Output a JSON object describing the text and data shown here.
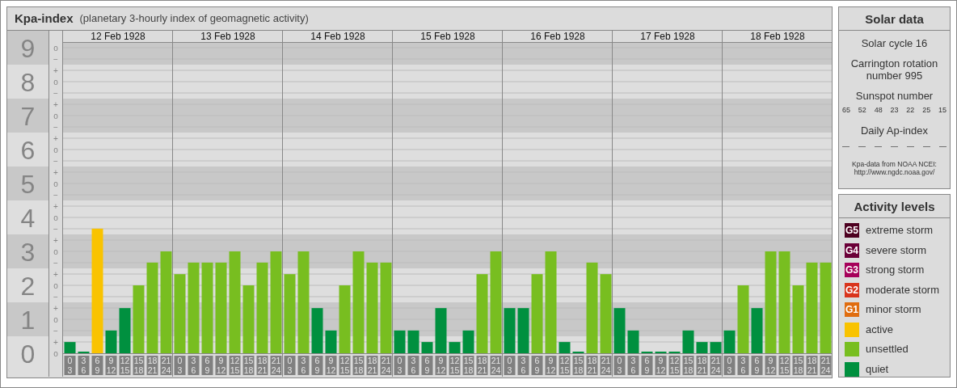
{
  "title": {
    "name": "Kpa-index",
    "subtitle": "(planetary 3-hourly index of geomagnetic activity)"
  },
  "chart": {
    "days": [
      {
        "date": "12 Feb 1928",
        "slots": [
          [
            "0",
            "3"
          ],
          [
            "3",
            "6"
          ],
          [
            "6",
            "9"
          ],
          [
            "9",
            "12"
          ],
          [
            "12",
            "15"
          ],
          [
            "15",
            "18"
          ],
          [
            "18",
            "21"
          ],
          [
            "21",
            "24"
          ]
        ]
      },
      {
        "date": "13 Feb 1928",
        "slots": [
          [
            "0",
            "3"
          ],
          [
            "3",
            "6"
          ],
          [
            "6",
            "9"
          ],
          [
            "9",
            "12"
          ],
          [
            "12",
            "15"
          ],
          [
            "15",
            "18"
          ],
          [
            "18",
            "21"
          ],
          [
            "21",
            "24"
          ]
        ]
      },
      {
        "date": "14 Feb 1928",
        "slots": [
          [
            "0",
            "3"
          ],
          [
            "3",
            "6"
          ],
          [
            "6",
            "9"
          ],
          [
            "9",
            "12"
          ],
          [
            "12",
            "15"
          ],
          [
            "15",
            "18"
          ],
          [
            "18",
            "21"
          ],
          [
            "21",
            "24"
          ]
        ]
      },
      {
        "date": "15 Feb 1928",
        "slots": [
          [
            "0",
            "3"
          ],
          [
            "3",
            "6"
          ],
          [
            "6",
            "9"
          ],
          [
            "9",
            "12"
          ],
          [
            "12",
            "15"
          ],
          [
            "15",
            "18"
          ],
          [
            "18",
            "21"
          ],
          [
            "21",
            "24"
          ]
        ]
      },
      {
        "date": "16 Feb 1928",
        "slots": [
          [
            "0",
            "3"
          ],
          [
            "3",
            "6"
          ],
          [
            "6",
            "9"
          ],
          [
            "9",
            "12"
          ],
          [
            "12",
            "15"
          ],
          [
            "15",
            "18"
          ],
          [
            "18",
            "21"
          ],
          [
            "21",
            "24"
          ]
        ]
      },
      {
        "date": "17 Feb 1928",
        "slots": [
          [
            "0",
            "3"
          ],
          [
            "3",
            "6"
          ],
          [
            "6",
            "9"
          ],
          [
            "9",
            "12"
          ],
          [
            "12",
            "15"
          ],
          [
            "15",
            "18"
          ],
          [
            "18",
            "21"
          ],
          [
            "21",
            "24"
          ]
        ]
      },
      {
        "date": "18 Feb 1928",
        "slots": [
          [
            "0",
            "3"
          ],
          [
            "3",
            "6"
          ],
          [
            "6",
            "9"
          ],
          [
            "9",
            "12"
          ],
          [
            "12",
            "15"
          ],
          [
            "15",
            "18"
          ],
          [
            "18",
            "21"
          ],
          [
            "21",
            "24"
          ]
        ]
      }
    ],
    "scale_marks": [
      [
        "o",
        "−"
      ],
      [
        "+",
        "o",
        "−"
      ],
      [
        "+",
        "o",
        "−"
      ],
      [
        "+",
        "o",
        "−"
      ],
      [
        "+",
        "o",
        "−"
      ],
      [
        "+",
        "o",
        "−"
      ],
      [
        "+",
        "o",
        "−"
      ],
      [
        "+",
        "o",
        "−"
      ],
      [
        "+",
        "o",
        "−"
      ],
      [
        "+",
        "o"
      ]
    ],
    "chart_data": {
      "type": "bar",
      "stacked": true,
      "grid": true,
      "ylim": [
        0,
        9
      ],
      "yticks": [
        0,
        1,
        2,
        3,
        4,
        5,
        6,
        7,
        8,
        9
      ],
      "series": [
        {
          "color": "#00903f",
          "values": [
            0.33,
            0,
            null,
            0.67,
            1.33,
            null,
            null,
            null,
            null,
            null,
            null,
            null,
            null,
            null,
            null,
            null,
            null,
            null,
            1.33,
            0.67,
            null,
            null,
            null,
            null,
            0.67,
            0.67,
            0.33,
            1.33,
            0.33,
            0.67,
            null,
            null,
            1.33,
            1.33,
            null,
            null,
            0.33,
            0,
            null,
            null,
            1.33,
            0.67,
            0,
            0,
            0,
            0.67,
            0.33,
            0.33,
            0.67,
            null,
            1.33,
            null,
            null,
            null,
            null,
            null
          ]
        },
        {
          "color": "#78be20",
          "values": [
            null,
            null,
            null,
            null,
            null,
            2,
            2.67,
            3,
            2.33,
            2.67,
            2.67,
            2.67,
            3,
            2,
            2.67,
            3,
            2.33,
            3,
            null,
            null,
            2,
            3,
            2.67,
            2.67,
            null,
            null,
            null,
            null,
            null,
            null,
            2.33,
            3,
            null,
            null,
            2.33,
            3,
            null,
            null,
            2.67,
            2.33,
            null,
            null,
            null,
            null,
            null,
            null,
            null,
            null,
            null,
            2,
            null,
            3,
            3,
            2,
            2.67,
            2.67
          ]
        },
        {
          "color": "#f9c300",
          "values": [
            null,
            null,
            3.67,
            null,
            null,
            null,
            null,
            null,
            null,
            null,
            null,
            null,
            null,
            null,
            null,
            null,
            null,
            null,
            null,
            null,
            null,
            null,
            null,
            null,
            null,
            null,
            null,
            null,
            null,
            null,
            null,
            null,
            null,
            null,
            null,
            null,
            null,
            null,
            null,
            null,
            null,
            null,
            null,
            null,
            null,
            null,
            null,
            null,
            null,
            null,
            null,
            null,
            null,
            null,
            null,
            null
          ]
        }
      ]
    }
  },
  "solar_data": {
    "title": "Solar data",
    "solar_cycle": "Solar cycle 16",
    "carrington": "Carrington rotation number 995",
    "sunspot_label": "Sunspot number",
    "sunspot_values": [
      "65",
      "52",
      "48",
      "23",
      "22",
      "25",
      "15"
    ],
    "ap_label": "Daily Ap-index",
    "ap_values": [
      "—",
      "—",
      "—",
      "—",
      "—",
      "—",
      "—"
    ],
    "source": "Kpa-data from NOAA NCEI:",
    "source_url": "http://www.ngdc.noaa.gov/"
  },
  "activity_levels": {
    "title": "Activity levels",
    "items": [
      {
        "code": "G5",
        "label": "extreme storm",
        "color": "#4d0020"
      },
      {
        "code": "G4",
        "label": "severe storm",
        "color": "#6b0038"
      },
      {
        "code": "G3",
        "label": "strong storm",
        "color": "#a6005a"
      },
      {
        "code": "G2",
        "label": "moderate storm",
        "color": "#d9341c"
      },
      {
        "code": "G1",
        "label": "minor storm",
        "color": "#e06d10"
      },
      {
        "label": "active",
        "color": "#f9c300"
      },
      {
        "label": "unsettled",
        "color": "#78be20"
      },
      {
        "label": "quiet",
        "color": "#00903f"
      }
    ]
  }
}
